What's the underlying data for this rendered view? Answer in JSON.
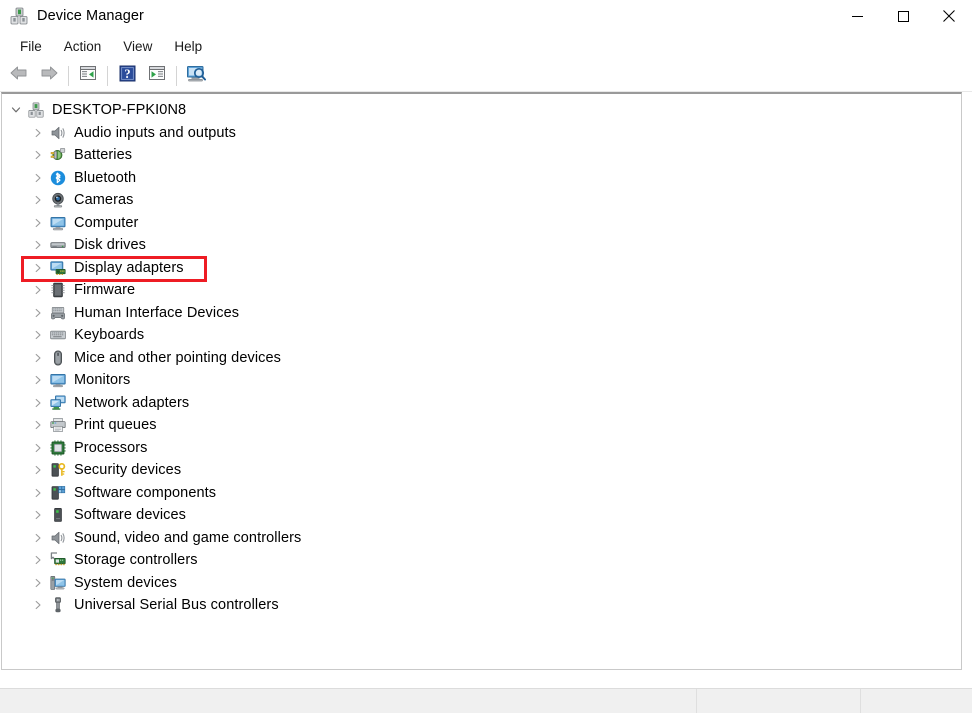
{
  "window": {
    "title": "Device Manager",
    "icon": "device-manager-icon",
    "controls": {
      "minimize": "minimize-icon",
      "maximize": "maximize-icon",
      "close": "close-icon"
    }
  },
  "menubar": {
    "items": [
      {
        "label": "File"
      },
      {
        "label": "Action"
      },
      {
        "label": "View"
      },
      {
        "label": "Help"
      }
    ]
  },
  "toolbar": {
    "buttons": [
      {
        "name": "back-button",
        "icon": "back-arrow-icon",
        "enabled": true
      },
      {
        "name": "forward-button",
        "icon": "forward-arrow-icon",
        "enabled": true
      },
      {
        "name": "properties-button",
        "icon": "properties-window-icon",
        "enabled": true
      },
      {
        "name": "help-button",
        "icon": "help-question-icon",
        "enabled": true
      },
      {
        "name": "update-driver-button",
        "icon": "update-driver-icon",
        "enabled": true
      },
      {
        "name": "scan-hardware-button",
        "icon": "scan-for-hardware-changes-icon",
        "enabled": true
      }
    ]
  },
  "tree": {
    "root": {
      "label": "DESKTOP-FPKI0N8",
      "icon": "computer-root-icon",
      "expanded": true
    },
    "items": [
      {
        "label": "Audio inputs and outputs",
        "icon": "speaker-icon",
        "expanded": false
      },
      {
        "label": "Batteries",
        "icon": "battery-plug-icon",
        "expanded": false
      },
      {
        "label": "Bluetooth",
        "icon": "bluetooth-icon",
        "expanded": false
      },
      {
        "label": "Cameras",
        "icon": "camera-icon",
        "expanded": false
      },
      {
        "label": "Computer",
        "icon": "monitor-icon",
        "expanded": false
      },
      {
        "label": "Disk drives",
        "icon": "disk-drive-icon",
        "expanded": false
      },
      {
        "label": "Display adapters",
        "icon": "display-adapter-icon",
        "expanded": false,
        "highlighted": true
      },
      {
        "label": "Firmware",
        "icon": "firmware-chip-icon",
        "expanded": false
      },
      {
        "label": "Human Interface Devices",
        "icon": "hid-gamepad-icon",
        "expanded": false
      },
      {
        "label": "Keyboards",
        "icon": "keyboard-icon",
        "expanded": false
      },
      {
        "label": "Mice and other pointing devices",
        "icon": "mouse-icon",
        "expanded": false
      },
      {
        "label": "Monitors",
        "icon": "monitor-screen-icon",
        "expanded": false
      },
      {
        "label": "Network adapters",
        "icon": "network-adapter-icon",
        "expanded": false
      },
      {
        "label": "Print queues",
        "icon": "printer-icon",
        "expanded": false
      },
      {
        "label": "Processors",
        "icon": "processor-chip-icon",
        "expanded": false
      },
      {
        "label": "Security devices",
        "icon": "security-key-icon",
        "expanded": false
      },
      {
        "label": "Software components",
        "icon": "software-component-icon",
        "expanded": false
      },
      {
        "label": "Software devices",
        "icon": "software-device-icon",
        "expanded": false
      },
      {
        "label": "Sound, video and game controllers",
        "icon": "sound-speaker-icon",
        "expanded": false
      },
      {
        "label": "Storage controllers",
        "icon": "storage-controller-icon",
        "expanded": false
      },
      {
        "label": "System devices",
        "icon": "system-device-icon",
        "expanded": false
      },
      {
        "label": "Universal Serial Bus controllers",
        "icon": "usb-icon",
        "expanded": false
      }
    ]
  },
  "annotation": {
    "highlight_color": "#ee1c24",
    "target": "Display adapters"
  },
  "statusbar": {
    "pane1": "",
    "pane2": "",
    "pane3": ""
  }
}
